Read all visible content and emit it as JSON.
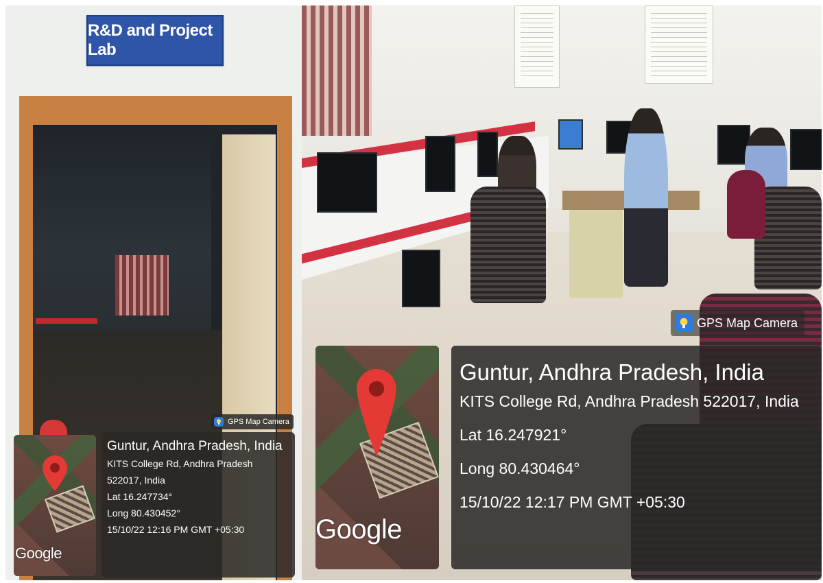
{
  "left": {
    "sign_text": "R&D and Project Lab",
    "gps": {
      "app_label": "GPS Map Camera",
      "map_logo": "Google",
      "title": "Guntur, Andhra Pradesh, India",
      "address_line1": "KITS College Rd, Andhra Pradesh",
      "address_line2": "522017, India",
      "lat": "Lat 16.247734°",
      "long": "Long 80.430452°",
      "datetime": "15/10/22 12:16 PM GMT +05:30"
    }
  },
  "right": {
    "gps": {
      "app_label": "GPS Map Camera",
      "map_logo": "Google",
      "title": "Guntur, Andhra Pradesh, India",
      "address": "KITS College Rd, Andhra Pradesh 522017, India",
      "lat": "Lat 16.247921°",
      "long": "Long 80.430464°",
      "datetime": "15/10/22 12:17 PM GMT +05:30"
    }
  },
  "icons": {
    "pin": "map-pin-icon",
    "app": "gps-map-camera-icon"
  },
  "colors": {
    "sign_blue": "#2f55a8",
    "pin_red": "#e53935",
    "overlay": "#2a2826"
  }
}
